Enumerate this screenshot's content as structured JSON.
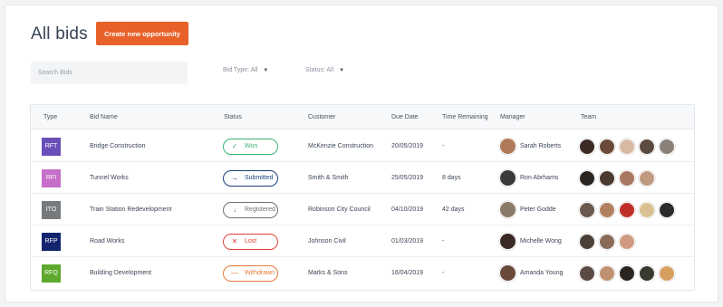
{
  "page": {
    "title": "All bids",
    "create_button": "Create new opportunity",
    "search_placeholder": "Search Bids",
    "filters": [
      {
        "label": "Bid Type: All"
      },
      {
        "label": "Status: All"
      }
    ]
  },
  "table": {
    "headers": [
      "Type",
      "Bid Name",
      "Status",
      "Customer",
      "Due Date",
      "Time Remaining",
      "Manager",
      "Team"
    ],
    "rows": [
      {
        "type": "RFT",
        "type_color": "#6a4fb8",
        "name": "Bridge Construction",
        "status": "Won",
        "status_icon": "check-icon",
        "status_color": "#3cb371",
        "customer": "McKenzie Construction",
        "due": "20/05/2019",
        "remaining": "-",
        "manager": "Sarah Roberts",
        "manager_color": "#b07a5a",
        "team": [
          "#3a2b25",
          "#6b4a3a",
          "#d9b8a2",
          "#5a4a40",
          "#8a8078"
        ]
      },
      {
        "type": "RFI",
        "type_color": "#c56fc9",
        "name": "Tunnel Works",
        "status": "Submitted",
        "status_icon": "arrow-right-icon",
        "status_color": "#1f3f7a",
        "customer": "Smith & Smith",
        "due": "25/05/2019",
        "remaining": "8 days",
        "manager": "Ron Abrhams",
        "manager_color": "#3a3a3a",
        "team": [
          "#2a2420",
          "#4a3a30",
          "#a87860",
          "#c09a80"
        ]
      },
      {
        "type": "ITO",
        "type_color": "#777a7d",
        "name": "Train Station Redevelopment",
        "status": "Registered",
        "status_icon": "arrow-down-icon",
        "status_color": "#6a7078",
        "customer": "Robinson City Council",
        "due": "04/10/2019",
        "remaining": "42 days",
        "manager": "Peter Godde",
        "manager_color": "#8a7a6a",
        "team": [
          "#6a5a50",
          "#b08060",
          "#c0302a",
          "#d8c090",
          "#2a2a2a"
        ]
      },
      {
        "type": "RFP",
        "type_color": "#13246e",
        "name": "Road Works",
        "status": "Lost",
        "status_icon": "close-icon",
        "status_color": "#e0433a",
        "customer": "Johnson Civil",
        "due": "01/03/2019",
        "remaining": "-",
        "manager": "Michelle Wong",
        "manager_color": "#3a2a25",
        "team": [
          "#4a4038",
          "#8a6a58",
          "#d09a80"
        ]
      },
      {
        "type": "RFQ",
        "type_color": "#5ea92e",
        "name": "Building Development",
        "status": "Withdrawn",
        "status_icon": "minus-icon",
        "status_color": "#e8793a",
        "customer": "Marks & Sons",
        "due": "16/04/2019",
        "remaining": "-",
        "manager": "Amanda Young",
        "manager_color": "#6a4a3a",
        "team": [
          "#5a4a44",
          "#c09070",
          "#2a2420",
          "#3a3a30",
          "#d8a060"
        ]
      }
    ]
  }
}
